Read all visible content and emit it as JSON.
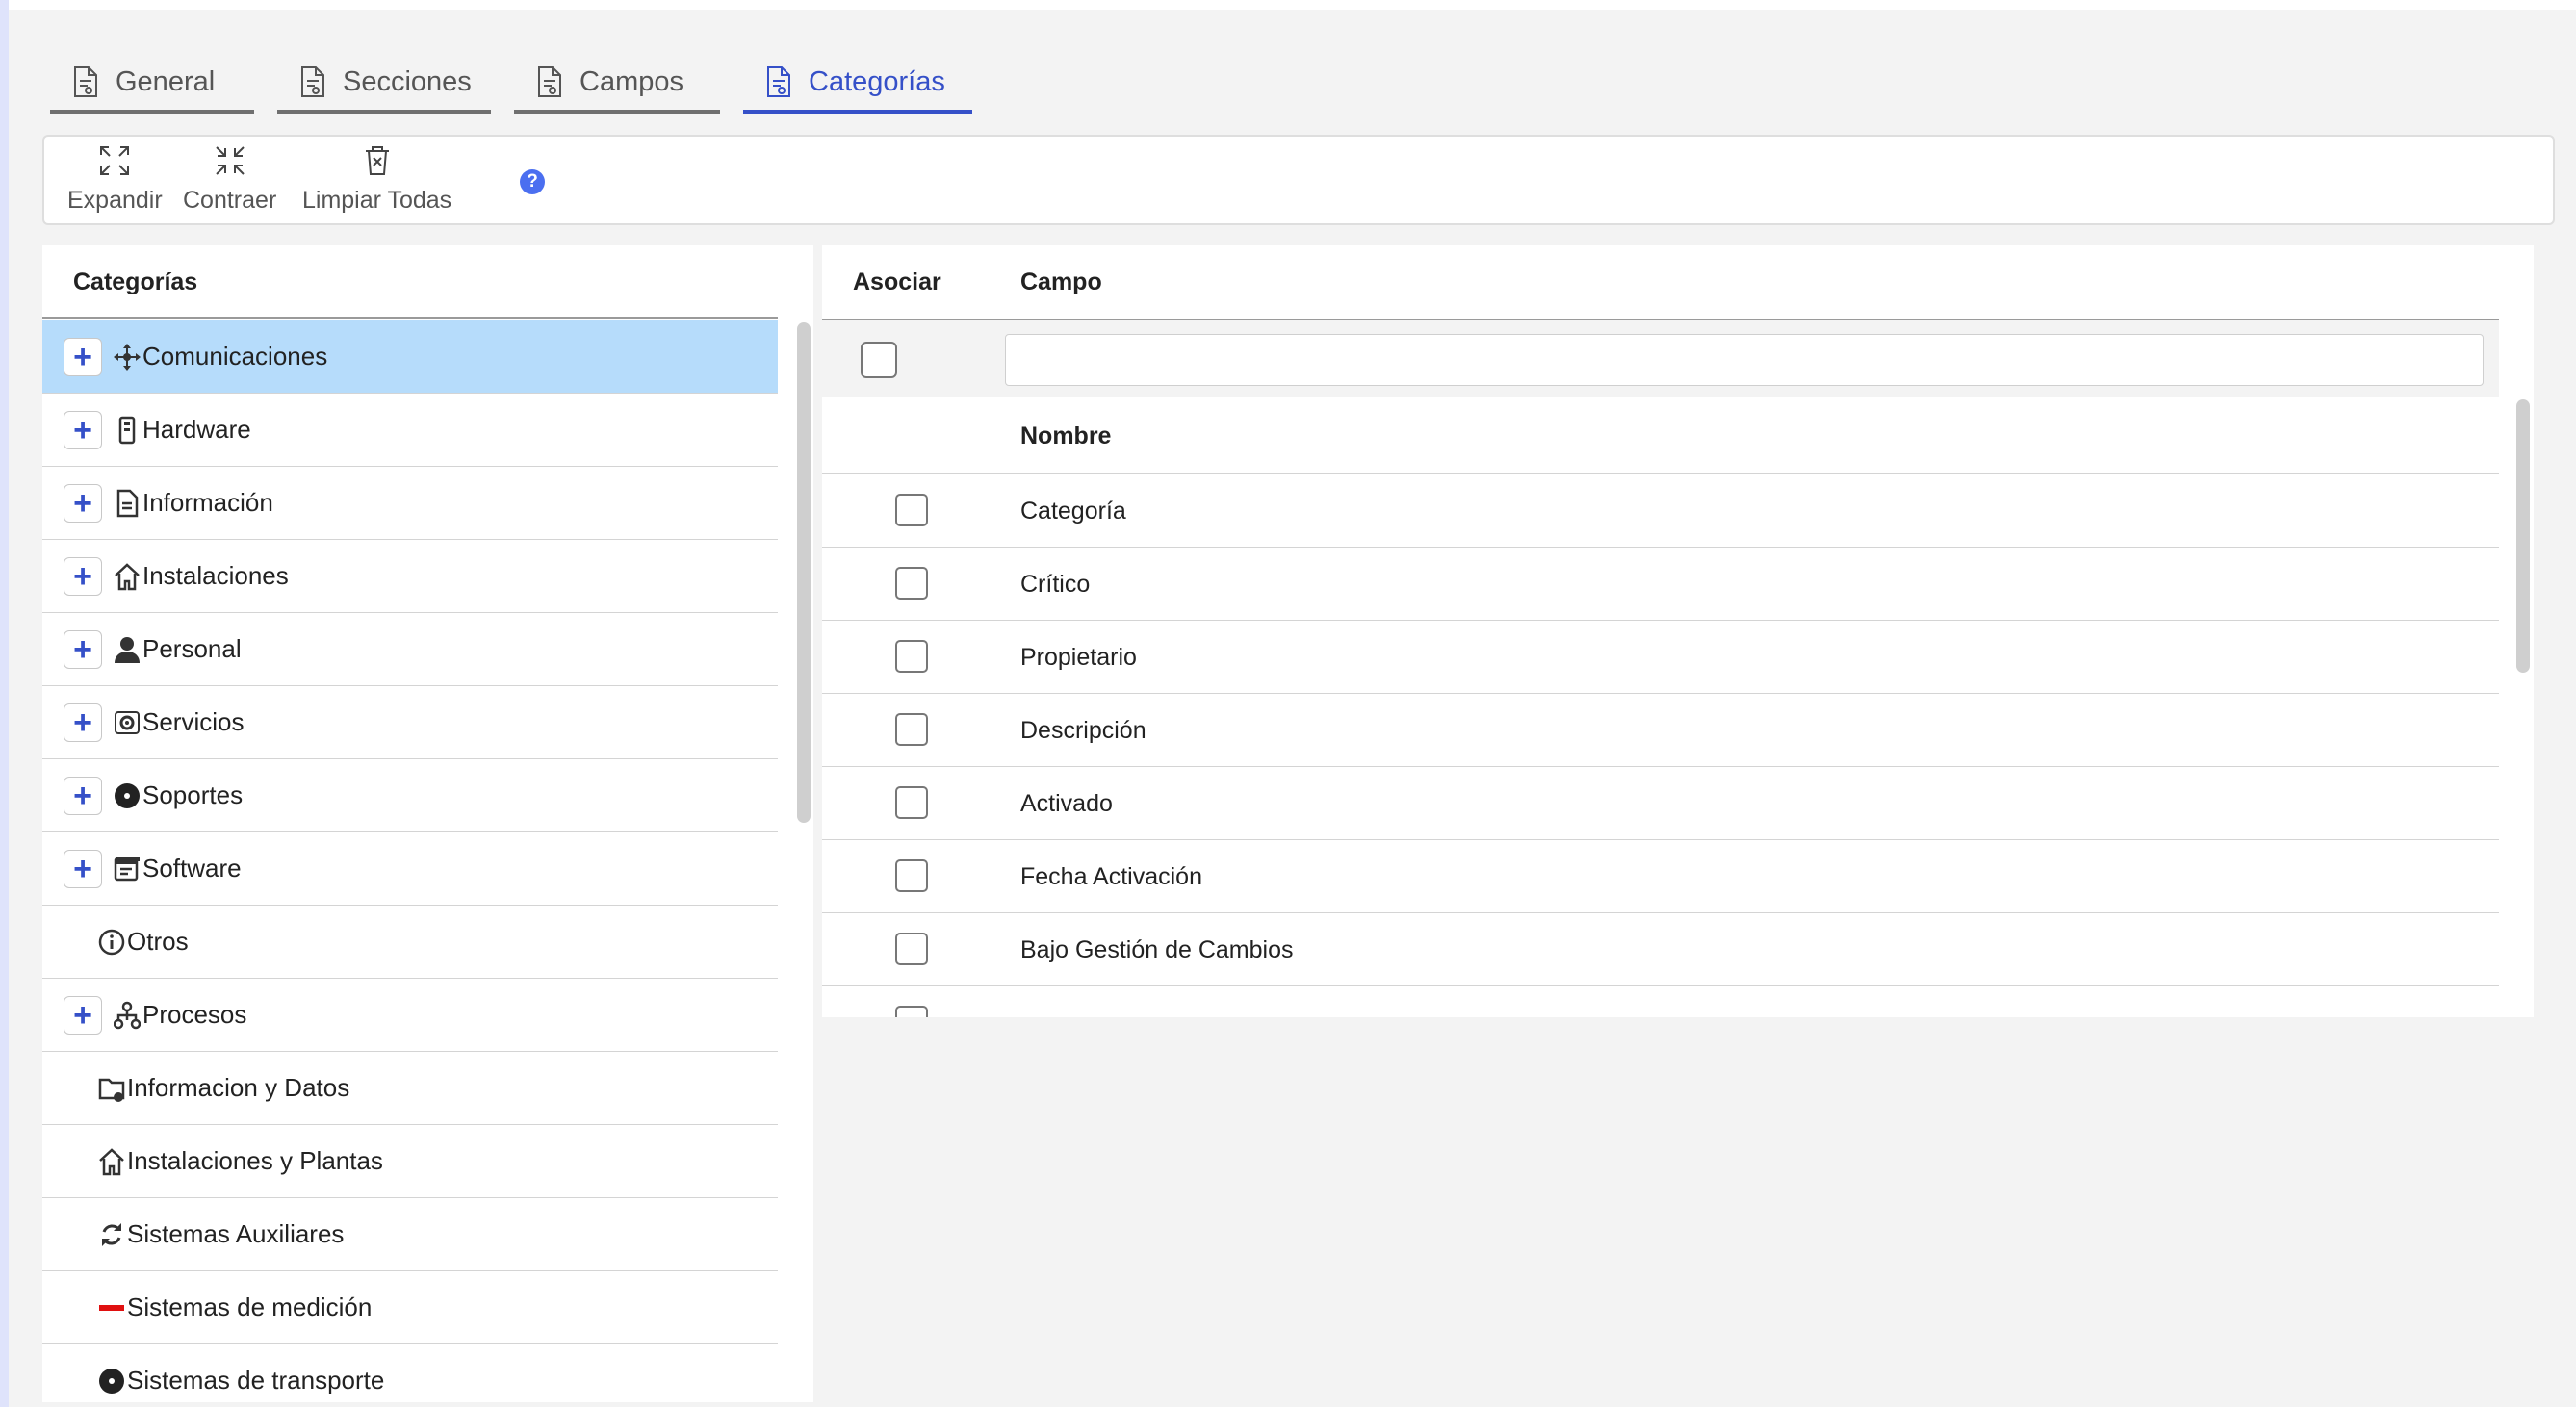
{
  "tabs": [
    {
      "label": "General",
      "active": false
    },
    {
      "label": "Secciones",
      "active": false
    },
    {
      "label": "Campos",
      "active": false
    },
    {
      "label": "Categorías",
      "active": true
    }
  ],
  "toolbar": {
    "expand_label": "Expandir",
    "collapse_label": "Contraer",
    "clear_label": "Limpiar Todas",
    "help_glyph": "?"
  },
  "categories_panel": {
    "title": "Categorías",
    "items": [
      {
        "label": "Comunicaciones",
        "icon": "network-icon",
        "expandable": true,
        "selected": true
      },
      {
        "label": "Hardware",
        "icon": "server-icon",
        "expandable": true
      },
      {
        "label": "Información",
        "icon": "document-icon",
        "expandable": true
      },
      {
        "label": "Instalaciones",
        "icon": "house-icon",
        "expandable": true
      },
      {
        "label": "Personal",
        "icon": "person-icon",
        "expandable": true
      },
      {
        "label": "Servicios",
        "icon": "services-icon",
        "expandable": true
      },
      {
        "label": "Soportes",
        "icon": "disc-icon",
        "expandable": true
      },
      {
        "label": "Software",
        "icon": "software-icon",
        "expandable": true
      },
      {
        "label": "Otros",
        "icon": "info-icon",
        "expandable": false
      },
      {
        "label": "Procesos",
        "icon": "hierarchy-icon",
        "expandable": true
      },
      {
        "label": "Informacion y Datos",
        "icon": "folder-data-icon",
        "expandable": false
      },
      {
        "label": "Instalaciones y Plantas",
        "icon": "house-icon",
        "expandable": false
      },
      {
        "label": "Sistemas Auxiliares",
        "icon": "refresh-icon",
        "expandable": false
      },
      {
        "label": "Sistemas de medición",
        "icon": "red-bar-icon",
        "expandable": false
      },
      {
        "label": "Sistemas de transporte",
        "icon": "disc-icon",
        "expandable": false
      }
    ],
    "expand_glyph": "+"
  },
  "fields_panel": {
    "col_associate": "Asociar",
    "col_field": "Campo",
    "filter_placeholder": "",
    "subheader": "Nombre",
    "rows": [
      {
        "label": "Categoría",
        "checked": false
      },
      {
        "label": "Crítico",
        "checked": false
      },
      {
        "label": "Propietario",
        "checked": false
      },
      {
        "label": "Descripción",
        "checked": false
      },
      {
        "label": "Activado",
        "checked": false
      },
      {
        "label": "Fecha Activación",
        "checked": false
      },
      {
        "label": "Bajo Gestión de Cambios",
        "checked": false
      }
    ]
  },
  "colors": {
    "accent": "#3550c8",
    "selected_row": "#b6dcfb",
    "help_badge": "#4b6ff0",
    "measurement_bar": "#e01010"
  }
}
